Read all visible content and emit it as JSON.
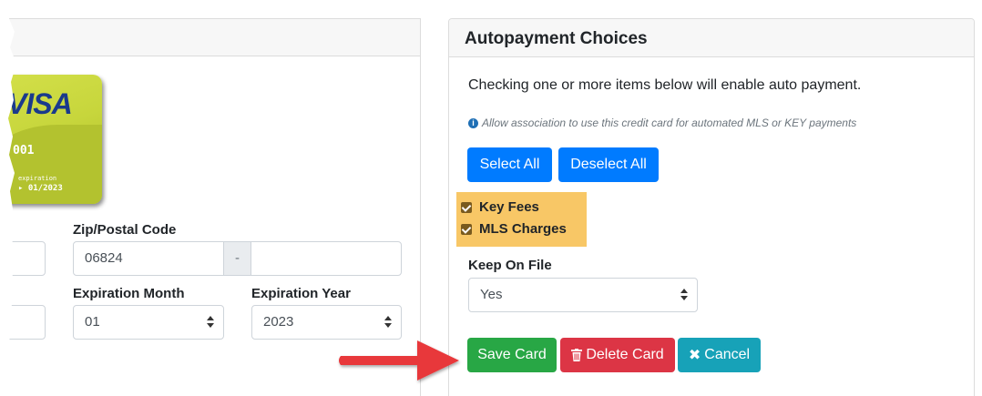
{
  "card": {
    "brand": "VISA",
    "number_suffix": "001",
    "expiration_label": "expiration",
    "expiration_value": "01/2023"
  },
  "left_form": {
    "zip_label": "Zip/Postal Code",
    "zip_value": "06824",
    "zip_separator": "-",
    "zip_ext_value": "",
    "exp_month_label": "Expiration Month",
    "exp_month_value": "01",
    "exp_year_label": "Expiration Year",
    "exp_year_value": "2023"
  },
  "autopay": {
    "title": "Autopayment Choices",
    "intro": "Checking one or more items below will enable auto payment.",
    "info_note": "Allow association to use this credit card for automated MLS or KEY payments",
    "select_all_label": "Select All",
    "deselect_all_label": "Deselect All",
    "options": [
      {
        "label": "Key Fees",
        "checked": true
      },
      {
        "label": "MLS Charges",
        "checked": true
      }
    ],
    "keep_on_file_label": "Keep On File",
    "keep_on_file_value": "Yes"
  },
  "actions": {
    "save_label": "Save Card",
    "delete_label": "Delete Card",
    "cancel_label": "Cancel"
  },
  "colors": {
    "primary": "#007bff",
    "success": "#28a745",
    "danger": "#dc3545",
    "info": "#17a2b8",
    "highlight": "#f8c766",
    "arrow": "#e8373b"
  }
}
